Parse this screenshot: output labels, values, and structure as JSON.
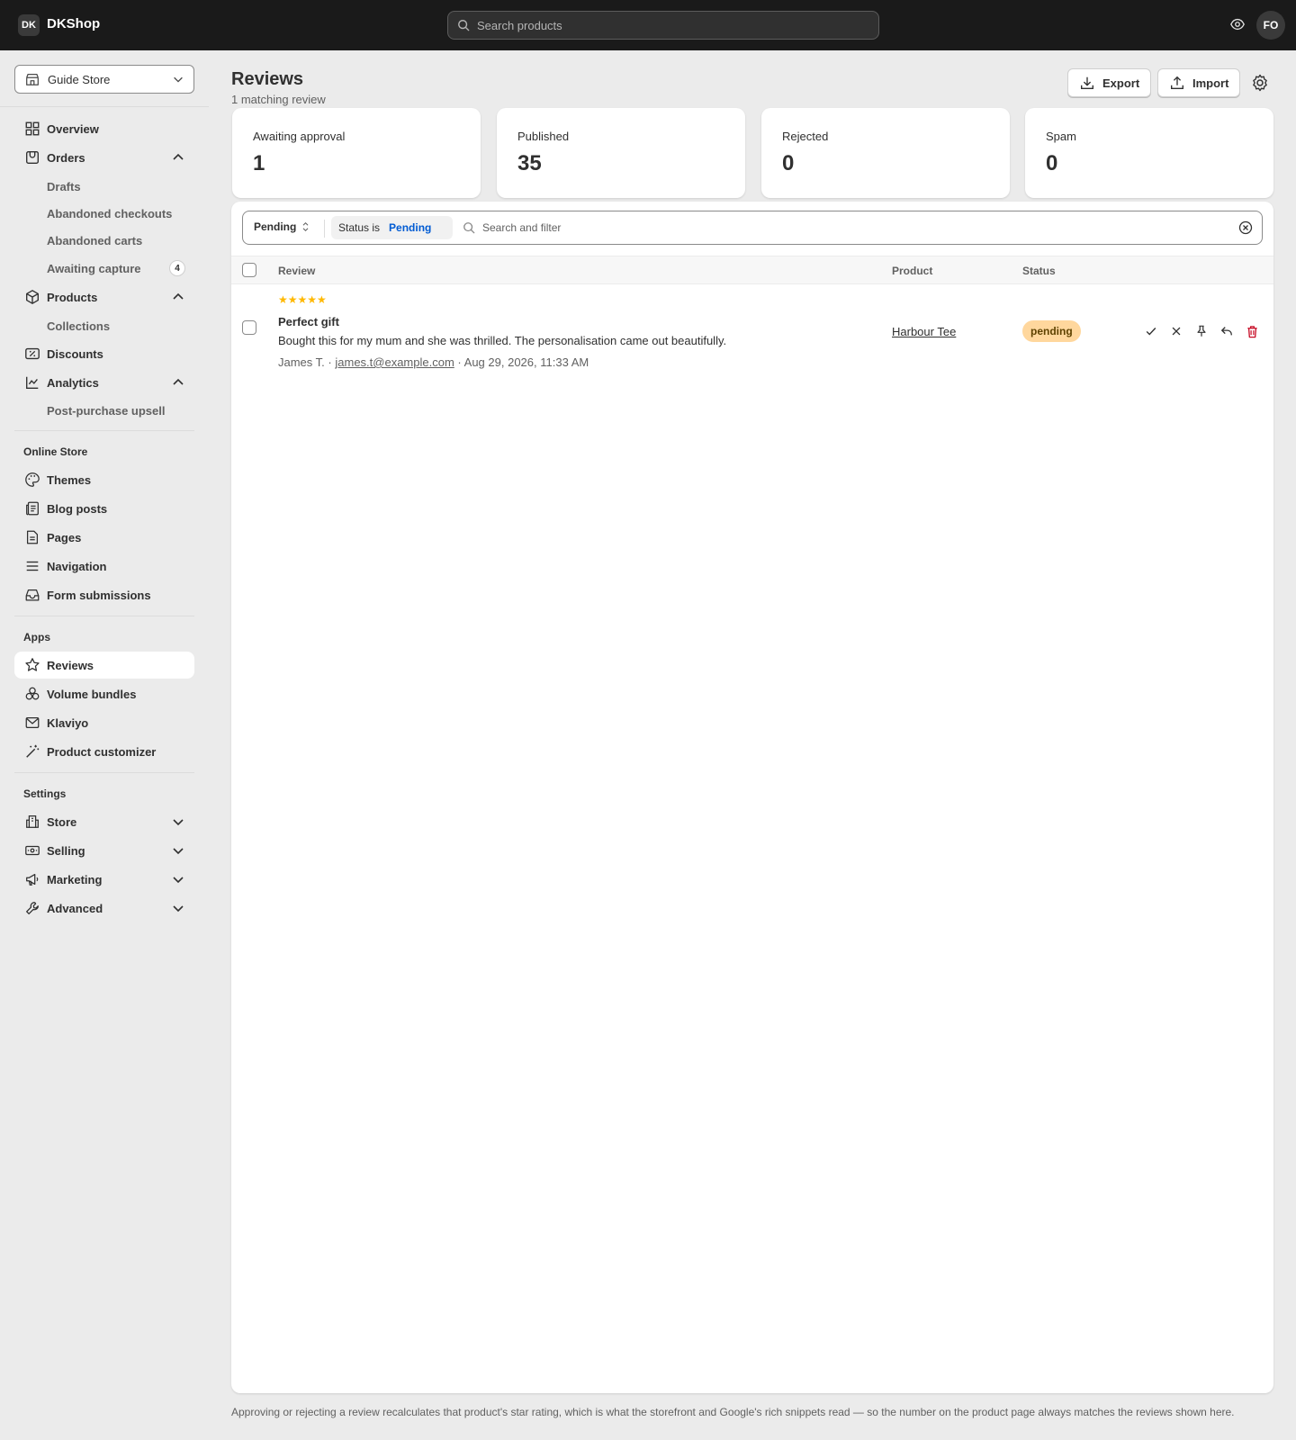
{
  "topbar": {
    "logo_initials": "DK",
    "brand": "DKShop",
    "search_placeholder": "Search products",
    "avatar_initials": "FO"
  },
  "sidebar": {
    "store_name": "Guide Store",
    "main_items": [
      {
        "label": "Overview",
        "icon": "overview-icon"
      },
      {
        "label": "Orders",
        "icon": "orders-icon",
        "expanded": true
      },
      {
        "label": "Products",
        "icon": "products-icon",
        "expanded": true
      },
      {
        "label": "Discounts",
        "icon": "discounts-icon"
      },
      {
        "label": "Analytics",
        "icon": "analytics-icon",
        "expanded": true
      }
    ],
    "order_sub_items": [
      "Drafts",
      "Abandoned checkouts",
      "Abandoned carts",
      "Awaiting capture"
    ],
    "awaiting_capture_count": "4",
    "product_sub_items": [
      "Collections"
    ],
    "analytics_sub_items": [
      "Post-purchase upsell"
    ],
    "online_store_label": "Online Store",
    "online_store_items": [
      "Themes",
      "Blog posts",
      "Pages",
      "Navigation",
      "Form submissions"
    ],
    "apps_label": "Apps",
    "apps_items": [
      "Reviews",
      "Volume bundles",
      "Klaviyo",
      "Product customizer"
    ],
    "active_item": "Reviews",
    "settings_label": "Settings",
    "settings_items": [
      "Store",
      "Selling",
      "Marketing",
      "Advanced"
    ]
  },
  "main": {
    "title": "Reviews",
    "subtitle": "1 matching review",
    "export_label": "Export",
    "import_label": "Import",
    "stats": [
      {
        "label": "Awaiting approval",
        "value": "1"
      },
      {
        "label": "Published",
        "value": "35"
      },
      {
        "label": "Rejected",
        "value": "0"
      },
      {
        "label": "Spam",
        "value": "0"
      }
    ],
    "filter": {
      "view_label": "Pending",
      "chip_key": "Status is",
      "chip_value": "Pending",
      "search_placeholder": "Search and filter"
    },
    "columns": {
      "review": "Review",
      "product": "Product",
      "status": "Status"
    },
    "reviews": [
      {
        "rating": 5,
        "stars": "★★★★★",
        "title": "Perfect gift",
        "body": "Bought this for my mum and she was thrilled. The personalisation came out beautifully.",
        "author": "James T.",
        "sep1": "·",
        "email": "james.t@example.com",
        "sep2": "·",
        "date": "Aug 29, 2026, 11:33 AM",
        "product": "Harbour Tee",
        "status": "pending"
      }
    ],
    "footnote": "Approving or rejecting a review recalculates that product's star rating, which is what the storefront and Google's rich snippets read — so the number on the product page always matches the reviews shown here."
  },
  "colors": {
    "topbar_bg": "#1a1a1a",
    "accent_blue": "#005bd3",
    "pending_badge": "#ffd79d",
    "star": "#ffb800",
    "delete_red": "#c70a24"
  }
}
